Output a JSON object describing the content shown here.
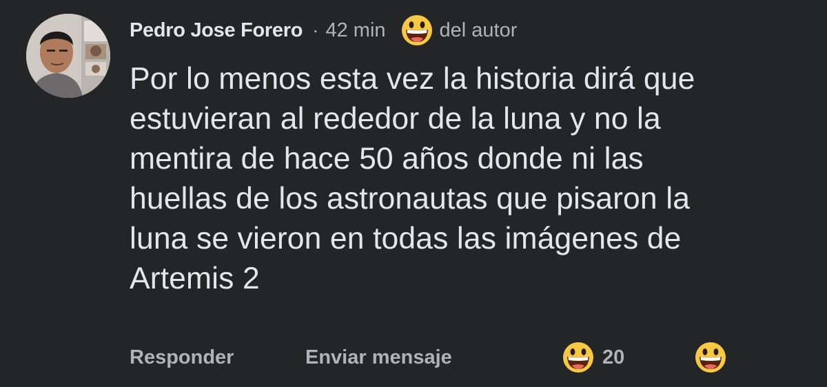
{
  "comment": {
    "author": {
      "name": "Pedro Jose Forero",
      "avatar_icon": "profile-photo",
      "separator": "·",
      "time": "42 min",
      "badge_icon": "grinning-face-emoji",
      "badge": "del autor"
    },
    "text": "Por lo menos esta vez la historia dirá que\nestuvieran al rededor de la luna y no la\nmentira de hace 50 años donde ni las\nhuellas de los astronautas que pisaron la\nluna se vieron en todas las imágenes de\nArtemis 2",
    "actions": {
      "reply_label": "Responder",
      "message_label": "Enviar mensaje"
    },
    "reactions": {
      "icon": "grinning-face-emoji",
      "count": "20"
    },
    "react_button_icon": "grinning-face-emoji"
  },
  "colors": {
    "background": "#242526",
    "primary_text": "#e4e6eb",
    "secondary_text": "#b0b3b8",
    "emoji_yellow": "#f7c843"
  }
}
